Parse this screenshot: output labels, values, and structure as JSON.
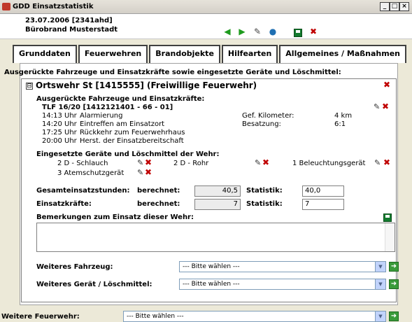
{
  "window": {
    "title": "GDD Einsatzstatistik",
    "buttons": [
      "_",
      "□",
      "×"
    ]
  },
  "header": {
    "date_line": "23.07.2006 [2341ahd]",
    "user_line": "Bürobrand Musterstadt"
  },
  "toolbar": {
    "icons": [
      "arrow-left-icon",
      "arrow-right-icon",
      "edit-icon",
      "globe-icon",
      "save-icon",
      "delete-icon"
    ]
  },
  "tabs": [
    "Grunddaten",
    "Feuerwehren",
    "Brandobjekte",
    "Hilfearten",
    "Allgemeines / Maßnahmen"
  ],
  "section_title": "Ausgerückte Fahrzeuge und Einsatzkräfte sowie eingesetzte Geräte und Löschmittel:",
  "fw": {
    "collapse": "⊟",
    "title": "Ortswehr St [1415555] (Freiwillige Feuerwehr)",
    "vehicles_label": "Ausgerückte Fahrzeuge und Einsatzkräfte:",
    "vehicle_name": "TLF 16/20 [1412121401 - 66 - 01]",
    "times": [
      {
        "time": "14:13 Uhr",
        "event": "Alarmierung"
      },
      {
        "time": "14:20 Uhr",
        "event": "Eintreffen am Einsatzort"
      },
      {
        "time": "17:25 Uhr",
        "event": "Rückkehr zum Feuerwehrhaus"
      },
      {
        "time": "20:00 Uhr",
        "event": "Herst. der Einsatzbereitschaft"
      }
    ],
    "km_label": "Gef. Kilometer:",
    "km_value": "4 km",
    "crew_label": "Besatzung:",
    "crew_value": "6:1",
    "devices_label": "Eingesetzte Geräte und Löschmittel der Wehr:",
    "devices": [
      "2 D - Schlauch",
      "2 D - Rohr",
      "1 Beleuchtungsgerät",
      "3 Atemschutzgerät"
    ],
    "hours_label": "Gesamteinsatzstunden:",
    "calc_label": "berechnet:",
    "hours_calc": "40,5",
    "stat_label": "Statistik:",
    "hours_stat": "40,0",
    "forces_label": "Einsatzkräfte:",
    "forces_calc": "7",
    "forces_stat": "7",
    "remarks_label": "Bemerkungen zum Einsatz dieser Wehr:",
    "more_vehicle_label": "Weiteres Fahrzeug:",
    "more_device_label": "Weiteres Gerät / Löschmittel:",
    "select_placeholder": "--- Bitte wählen ---"
  },
  "footer": {
    "more_fw_label": "Weitere Feuerwehr:",
    "select_placeholder": "--- Bitte wählen ---"
  }
}
